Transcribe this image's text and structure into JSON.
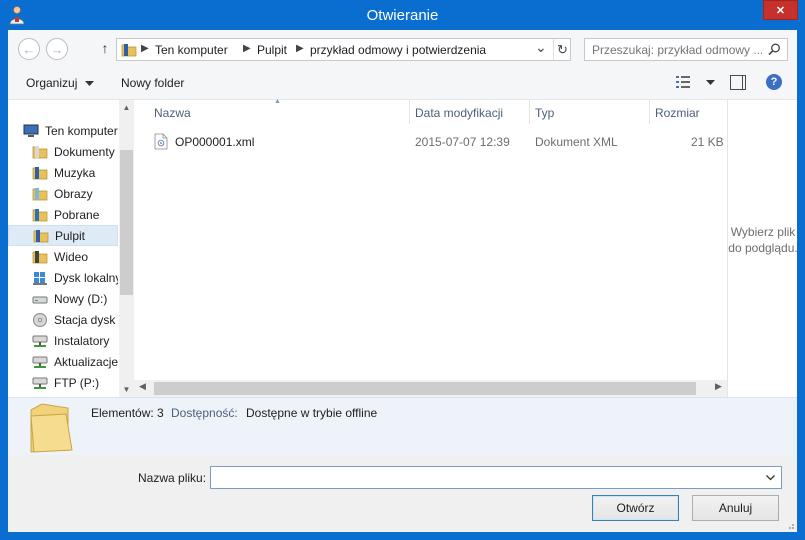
{
  "window": {
    "title": "Otwieranie",
    "close_glyph": "✕"
  },
  "address": {
    "back_glyph": "←",
    "forward_glyph": "→",
    "up_glyph": "↑",
    "segments": [
      "Ten komputer",
      "Pulpit",
      "przykład odmowy i potwierdzenia"
    ],
    "separator": "▶",
    "dropdown_glyph": "⌄",
    "refresh_glyph": "↻"
  },
  "search": {
    "placeholder": "Przeszukaj: przykład odmowy ...",
    "icon": "search-icon"
  },
  "toolbar": {
    "organize_label": "Organizuj",
    "new_folder_label": "Nowy folder",
    "help_glyph": "?"
  },
  "nav": {
    "items": [
      {
        "label": "Ten komputer",
        "icon": "computer-icon",
        "selected": false
      },
      {
        "label": "Dokumenty",
        "icon": "documents-folder-icon",
        "selected": false
      },
      {
        "label": "Muzyka",
        "icon": "music-folder-icon",
        "selected": false
      },
      {
        "label": "Obrazy",
        "icon": "pictures-folder-icon",
        "selected": false
      },
      {
        "label": "Pobrane",
        "icon": "downloads-folder-icon",
        "selected": false
      },
      {
        "label": "Pulpit",
        "icon": "desktop-folder-icon",
        "selected": true
      },
      {
        "label": "Wideo",
        "icon": "videos-folder-icon",
        "selected": false
      },
      {
        "label": "Dysk lokalny",
        "icon": "local-disk-icon",
        "selected": false
      },
      {
        "label": "Nowy (D:)",
        "icon": "drive-icon",
        "selected": false
      },
      {
        "label": "Stacja dysk",
        "icon": "optical-drive-icon",
        "selected": false
      },
      {
        "label": "Instalatory",
        "icon": "network-drive-icon",
        "selected": false
      },
      {
        "label": "Aktualizacje",
        "icon": "network-drive-icon",
        "selected": false
      },
      {
        "label": "FTP (P:)",
        "icon": "network-drive-icon",
        "selected": false
      }
    ],
    "scroll_up_glyph": "▲",
    "scroll_down_glyph": "▼"
  },
  "filelist": {
    "columns": [
      "Nazwa",
      "Data modyfikacji",
      "Typ",
      "Rozmiar"
    ],
    "sort_glyph": "▲",
    "rows": [
      {
        "name": "OP000001.xml",
        "modified": "2015-07-07 12:39",
        "type": "Dokument XML",
        "size": "21 KB"
      }
    ],
    "scroll_left_glyph": "◀",
    "scroll_right_glyph": "▶"
  },
  "preview": {
    "text": "Wybierz plik do podglądu."
  },
  "details": {
    "count_label": "Elementów: 3",
    "availability_label": "Dostępność:",
    "availability_value": "Dostępne w trybie offline"
  },
  "bottom": {
    "filename_label": "Nazwa pliku:",
    "filename_value": "",
    "open_label": "Otwórz",
    "cancel_label": "Anuluj"
  },
  "colors": {
    "title_bar": "#0a6ed1",
    "close_button": "#c7312b",
    "details_bg": "#eef3fa",
    "selected_bg": "#dfeaf7"
  }
}
